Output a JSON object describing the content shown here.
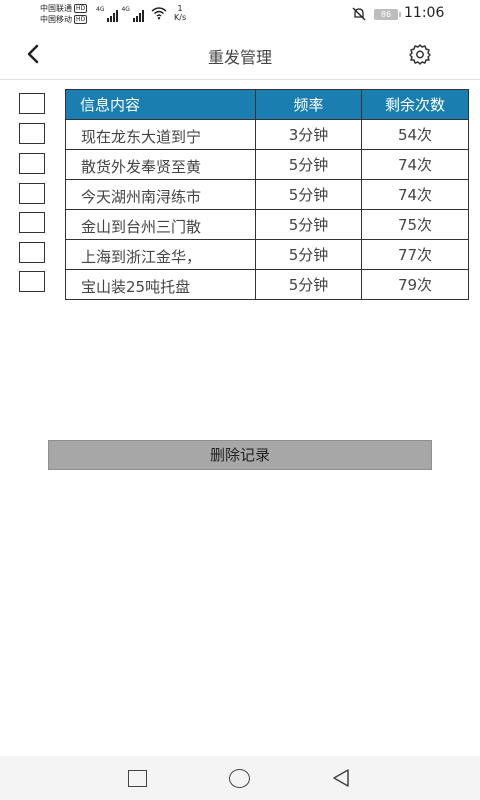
{
  "status_bar": {
    "carrier1": "中国联通",
    "carrier2": "中国移动",
    "hd_badge": "HD",
    "net1": "4G",
    "net2": "4G",
    "speed_value": "1",
    "speed_unit": "K/s",
    "battery": "86",
    "time": "11:06"
  },
  "header": {
    "title": "重发管理",
    "back_icon": "chevron-left-icon",
    "settings_icon": "gear-icon"
  },
  "table": {
    "columns": [
      "信息内容",
      "频率",
      "剩余次数"
    ],
    "rows": [
      {
        "content": "现在龙东大道到宁",
        "frequency": "3分钟",
        "remaining": "54次"
      },
      {
        "content": "散货外发奉贤至黄",
        "frequency": "5分钟",
        "remaining": "74次"
      },
      {
        "content": "今天湖州南浔练市",
        "frequency": "5分钟",
        "remaining": "74次"
      },
      {
        "content": "金山到台州三门散",
        "frequency": "5分钟",
        "remaining": "75次"
      },
      {
        "content": "上海到浙江金华，",
        "frequency": "5分钟",
        "remaining": "77次"
      },
      {
        "content": "宝山装25吨托盘",
        "frequency": "5分钟",
        "remaining": "79次"
      }
    ]
  },
  "delete_button": {
    "label": "删除记录"
  },
  "colors": {
    "header_bg": "#1a7fb0",
    "button_bg": "#a7a7a7"
  }
}
